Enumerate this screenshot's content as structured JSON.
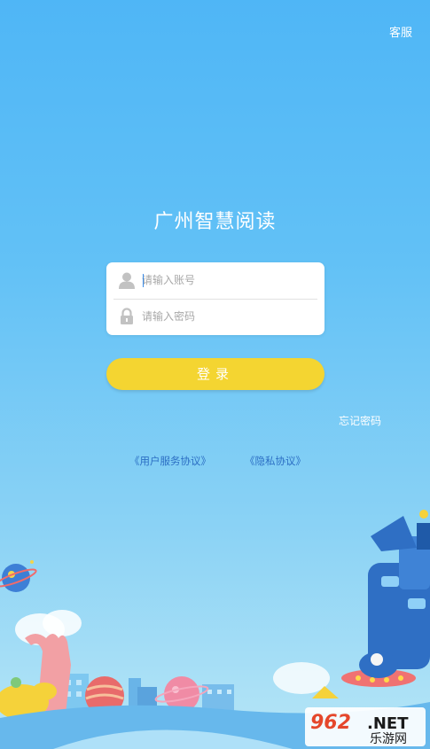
{
  "header": {
    "service_label": "客服"
  },
  "app": {
    "title": "广州智慧阅读"
  },
  "login_form": {
    "account_placeholder": "请输入账号",
    "password_placeholder": "请输入密码",
    "login_label": "登录",
    "forgot_password_label": "忘记密码"
  },
  "agreements": {
    "user_service": "《用户服务协议》",
    "privacy": "《隐私协议》"
  },
  "watermark": {
    "number": "962",
    "tld": ".NET",
    "site_name": "乐游网"
  },
  "icons": {
    "account": "user-silhouette-icon",
    "password": "lock-icon"
  },
  "colors": {
    "background_top": "#4fb6f6",
    "background_bottom": "#b7e6f6",
    "login_button": "#f4d531",
    "agreement_link": "#2c6fc4",
    "card": "#ffffff"
  }
}
